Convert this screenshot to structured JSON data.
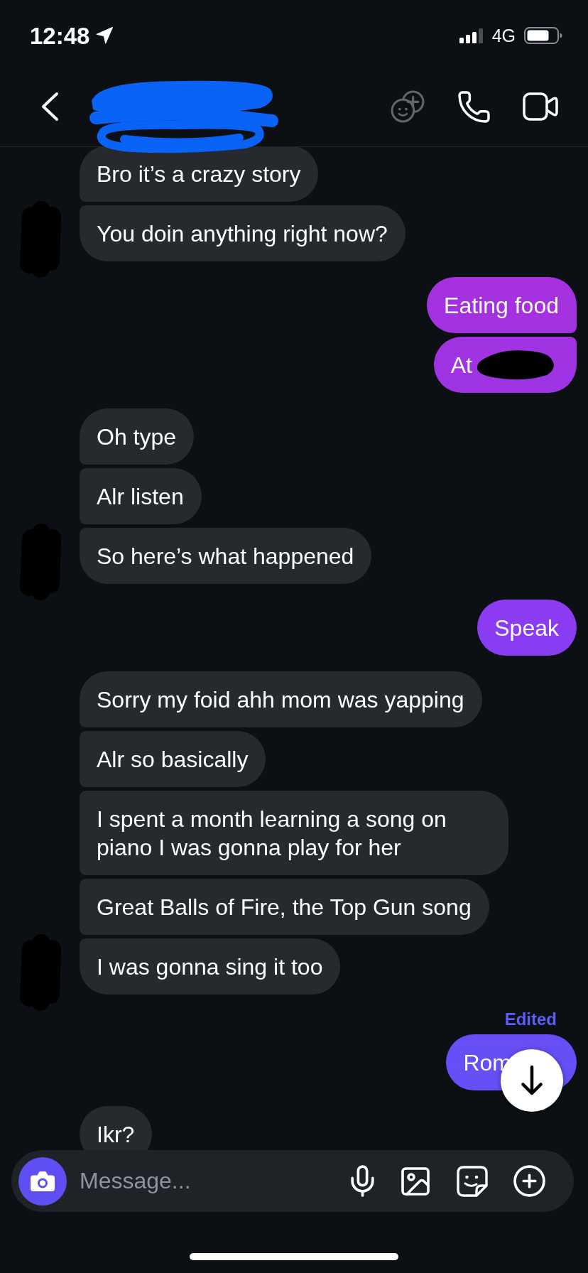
{
  "status_bar": {
    "time": "12:48",
    "network": "4G"
  },
  "header": {
    "name_redacted": true
  },
  "conversation": [
    {
      "outgoing": false,
      "avatar_redacted": true,
      "messages": [
        {
          "text": "Bro it’s a crazy story"
        },
        {
          "text": "You doin anything right now?"
        }
      ]
    },
    {
      "outgoing": true,
      "messages": [
        {
          "text": "Eating food"
        },
        {
          "text": "At",
          "redacted": true
        }
      ]
    },
    {
      "outgoing": false,
      "avatar_redacted": true,
      "messages": [
        {
          "text": "Oh type"
        },
        {
          "text": "Alr listen"
        },
        {
          "text": "So here’s what happened"
        }
      ]
    },
    {
      "outgoing": true,
      "messages": [
        {
          "text": "Speak"
        }
      ]
    },
    {
      "outgoing": false,
      "avatar_redacted": true,
      "messages": [
        {
          "text": "Sorry my foid ahh mom was yapping"
        },
        {
          "text": "Alr so basically"
        },
        {
          "text": "I spent a month learning a song on piano I was gonna play for her"
        },
        {
          "text": "Great Balls of Fire, the Top Gun song"
        },
        {
          "text": "I was gonna sing it too"
        }
      ]
    },
    {
      "outgoing": true,
      "messages": [
        {
          "text": "Rom",
          "edited_label": "Edited",
          "covered": true
        }
      ]
    },
    {
      "outgoing": false,
      "messages": [
        {
          "text": "Ikr?"
        }
      ]
    }
  ],
  "composer": {
    "placeholder": "Message..."
  }
}
